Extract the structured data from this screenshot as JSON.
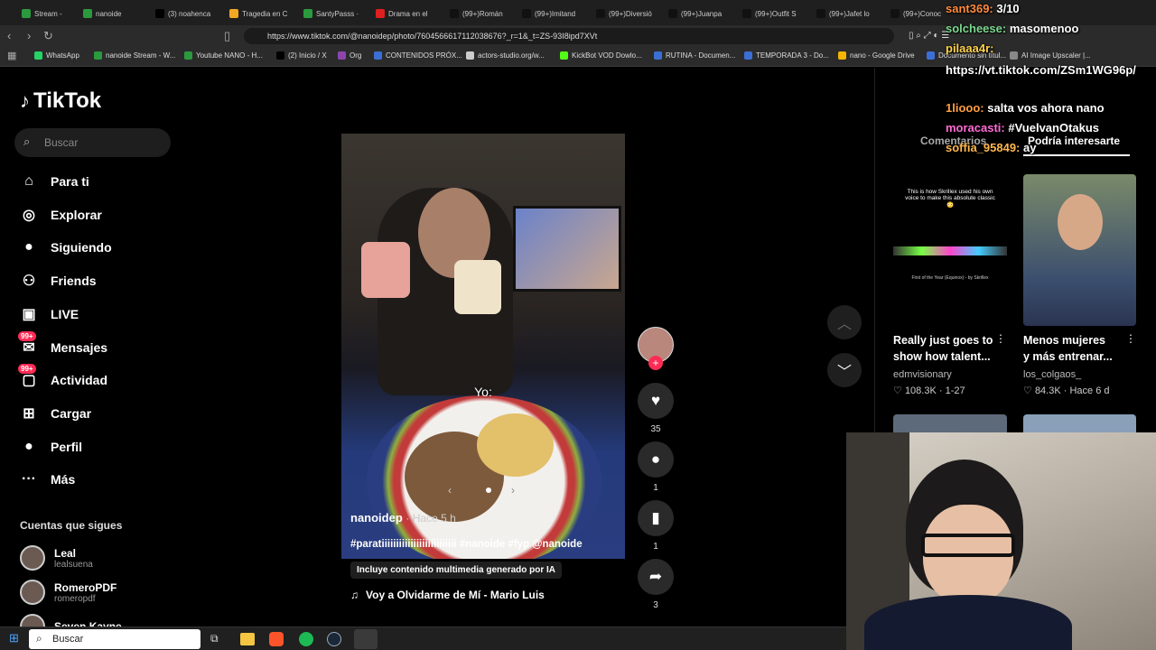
{
  "browser": {
    "tabs": [
      {
        "label": "Stream -",
        "color": "#2b9a3e"
      },
      {
        "label": "nanoide",
        "color": "#2b9a3e"
      },
      {
        "label": "(3) noahenca",
        "color": "#000000"
      },
      {
        "label": "Tragedia en C",
        "color": "#f5a623"
      },
      {
        "label": "SantyPasss ·",
        "color": "#2b9a3e"
      },
      {
        "label": "Drama en el",
        "color": "#e02020"
      },
      {
        "label": "(99+)Román",
        "color": "#111111"
      },
      {
        "label": "(99+)Imitand",
        "color": "#111111"
      },
      {
        "label": "(99+)Diversió",
        "color": "#111111"
      },
      {
        "label": "(99+)Juanpa",
        "color": "#111111"
      },
      {
        "label": "(99+)Outfit S",
        "color": "#111111"
      },
      {
        "label": "(99+)Jafet lo",
        "color": "#111111"
      },
      {
        "label": "(99+)Conoc",
        "color": "#111111"
      }
    ],
    "url": "https://www.tiktok.com/@nanoidep/photo/7604566617112038676?_r=1&_t=ZS-93I8ipd7XVt",
    "bookmarks": [
      {
        "label": "WhatsApp",
        "color": "#25d366"
      },
      {
        "label": "nanoide Stream - W...",
        "color": "#2b9a3e"
      },
      {
        "label": "Youtube NANO - H...",
        "color": "#2b9a3e"
      },
      {
        "label": "(2) Inicio / X",
        "color": "#000000"
      },
      {
        "label": "Org",
        "color": "#8e44ad"
      },
      {
        "label": "CONTENIDOS PRÓX...",
        "color": "#3b6fd6"
      },
      {
        "label": "actors-studio.org/w...",
        "color": "#cccccc"
      },
      {
        "label": "KickBot VOD Dowlo...",
        "color": "#53fc18"
      },
      {
        "label": "RUTINA - Documen...",
        "color": "#3b6fd6"
      },
      {
        "label": "TEMPORADA 3 - Do...",
        "color": "#3b6fd6"
      },
      {
        "label": "nano - Google Drive",
        "color": "#f4b400"
      },
      {
        "label": "Documento sin títul...",
        "color": "#3b6fd6"
      },
      {
        "label": "AI Image Upscaler |...",
        "color": "#888888"
      }
    ]
  },
  "tiktok": {
    "logo": "TikTok",
    "search_placeholder": "Buscar",
    "nav": [
      {
        "label": "Para ti",
        "icon": "home-icon",
        "glyph": "⌂"
      },
      {
        "label": "Explorar",
        "icon": "compass-icon",
        "glyph": "◎"
      },
      {
        "label": "Siguiendo",
        "icon": "avatar-icon",
        "glyph": "●"
      },
      {
        "label": "Friends",
        "icon": "friends-icon",
        "glyph": "⚇"
      },
      {
        "label": "LIVE",
        "icon": "live-tv-icon",
        "glyph": "▣"
      },
      {
        "label": "Mensajes",
        "icon": "message-icon",
        "glyph": "✉",
        "badge": "99+"
      },
      {
        "label": "Actividad",
        "icon": "activity-icon",
        "glyph": "▢",
        "badge": "99+"
      },
      {
        "label": "Cargar",
        "icon": "upload-icon",
        "glyph": "⊞"
      },
      {
        "label": "Perfil",
        "icon": "profile-icon",
        "glyph": "●"
      },
      {
        "label": "Más",
        "icon": "more-icon",
        "glyph": "···"
      }
    ],
    "following_title": "Cuentas que sigues",
    "following": [
      {
        "name": "Leal",
        "handle": "lealsuena"
      },
      {
        "name": "RomeroPDF",
        "handle": "romeropdf"
      },
      {
        "name": "Seven Kayne",
        "handle": ""
      }
    ],
    "post": {
      "overlay_text": "Yo:",
      "author": "nanoidep",
      "time": "· Hace 5 h",
      "caption": "#paratiiiiiiiiiiiiiiiiiiiiiiiiii #nanoide #fyp @nanoide",
      "ai_label": "Incluye contenido multimedia generado por IA",
      "music": "Voy a Olvidarme de Mí - Mario Luis",
      "likes": "35",
      "comments": "1",
      "saves": "1",
      "shares": "3"
    },
    "right_tabs": [
      "Comentarios",
      "Podría interesarte"
    ],
    "suggestions": [
      {
        "title": "Really just goes to show how talent...",
        "author": "edmvisionary",
        "likes": "108.3K",
        "date": "1-27",
        "thumb_text": "This is how Skrillex used his own voice to make this absolute classic 😳",
        "thumb_sub": "First of the Year (Equinox) - by Skrillex"
      },
      {
        "title": "Menos mujeres y más entrenar...",
        "author": "los_colgaos_",
        "likes": "84.3K",
        "date": "Hace 6 d"
      }
    ]
  },
  "chat": [
    {
      "user": "sant369:",
      "msg": " 3/10",
      "color": "#ff8a3d"
    },
    {
      "user": "solcheese:",
      "msg": " masomenoo",
      "color": "#7bd88f"
    },
    {
      "user": "pilaaa4r:",
      "msg": "",
      "color": "#ffd24d"
    },
    {
      "user": "",
      "msg": "https://vt.tiktok.com/ZSm1WG96p/",
      "color": "#ffffff"
    },
    {
      "user": "1liooo:",
      "msg": " salta vos ahora nano",
      "color": "#ff9f40"
    },
    {
      "user": "moracasti:",
      "msg": " #VuelvanOtakus",
      "color": "#ff6bd6"
    },
    {
      "user": "soffia_95849:",
      "msg": " ay",
      "color": "#ffb74d"
    }
  ],
  "taskbar": {
    "search_placeholder": "Buscar"
  }
}
